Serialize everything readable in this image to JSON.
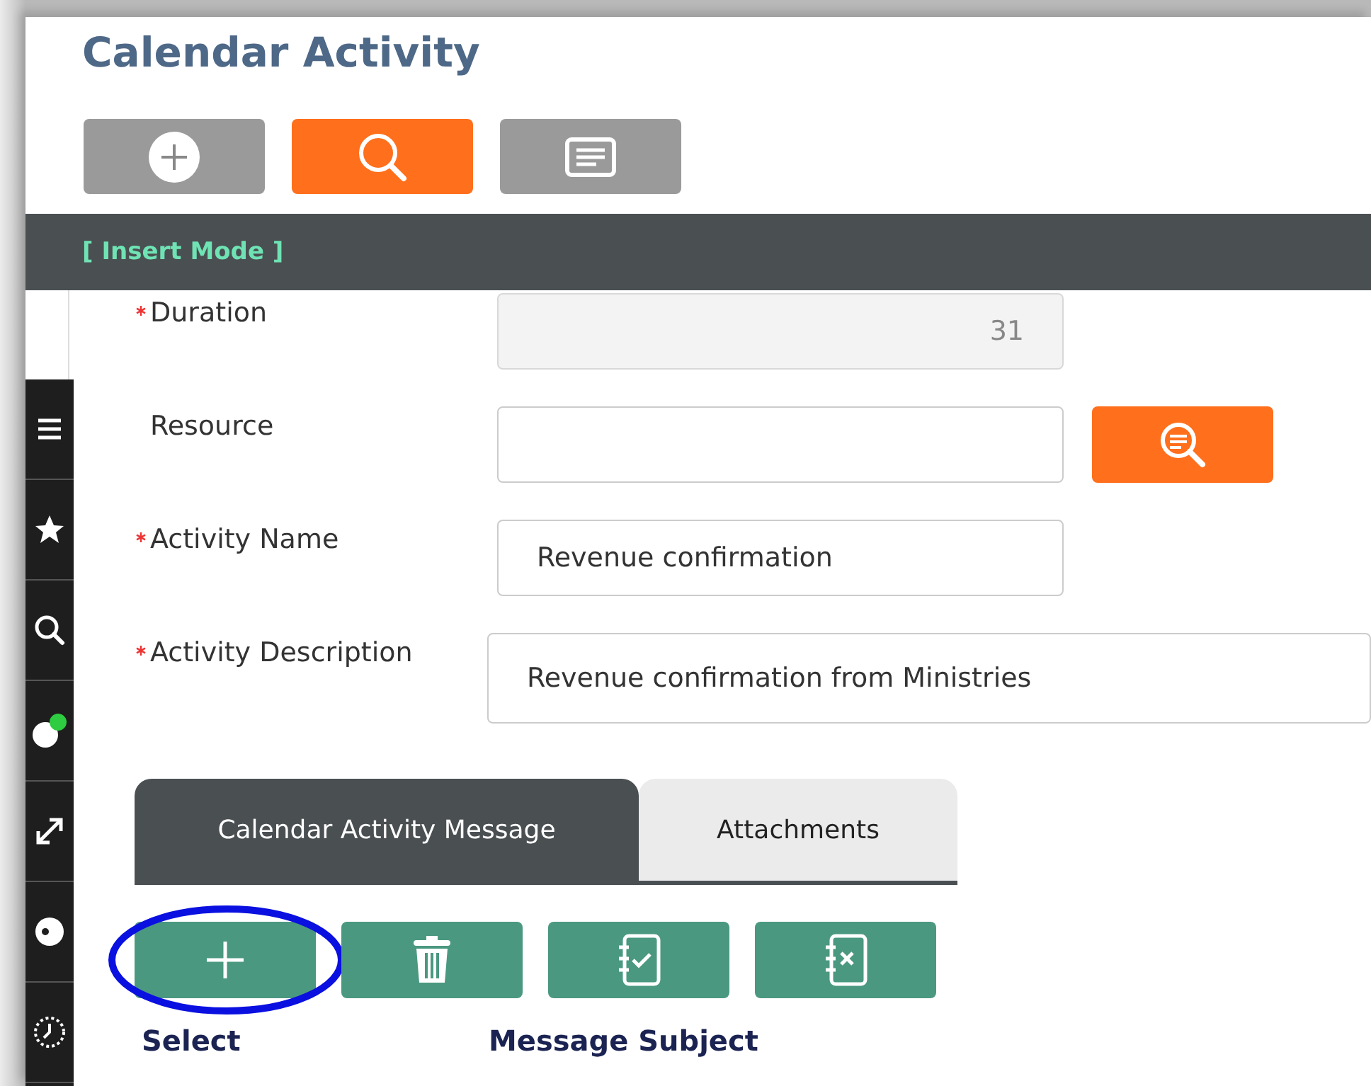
{
  "window": {
    "title": "Calendar Activity"
  },
  "toolbar": [
    {
      "kind": "add"
    },
    {
      "kind": "search"
    },
    {
      "kind": "list"
    }
  ],
  "mode": "[ Insert Mode ]",
  "sidebar": [
    {
      "kind": "menu"
    },
    {
      "kind": "star"
    },
    {
      "kind": "search"
    },
    {
      "kind": "status",
      "color": "#2ecc40"
    },
    {
      "kind": "expand"
    },
    {
      "kind": "circle"
    },
    {
      "kind": "clock"
    }
  ],
  "fields": [
    {
      "kind": "number",
      "label": "Duration",
      "required": true,
      "value": "31",
      "disabled": true
    },
    {
      "kind": "lookup",
      "label": "Resource",
      "required": false,
      "disabled": false
    },
    {
      "kind": "text",
      "label": "Activity Name",
      "required": true,
      "value": "Revenue confirmation",
      "disabled": false
    },
    {
      "kind": "multiline",
      "label": "Activity Description",
      "required": true,
      "value": "Revenue confirmation from Ministries",
      "disabled": false
    }
  ],
  "tabs": [
    {
      "label": "Calendar Activity Message",
      "selected": true
    },
    {
      "label": "Attachments",
      "selected": false
    }
  ],
  "actions": [
    {
      "kind": "add",
      "highlighted": true
    },
    {
      "kind": "delete",
      "highlighted": false
    },
    {
      "kind": "approve",
      "highlighted": false
    },
    {
      "kind": "reject",
      "highlighted": false
    }
  ],
  "columns": [
    "Select",
    "Message Subject"
  ]
}
